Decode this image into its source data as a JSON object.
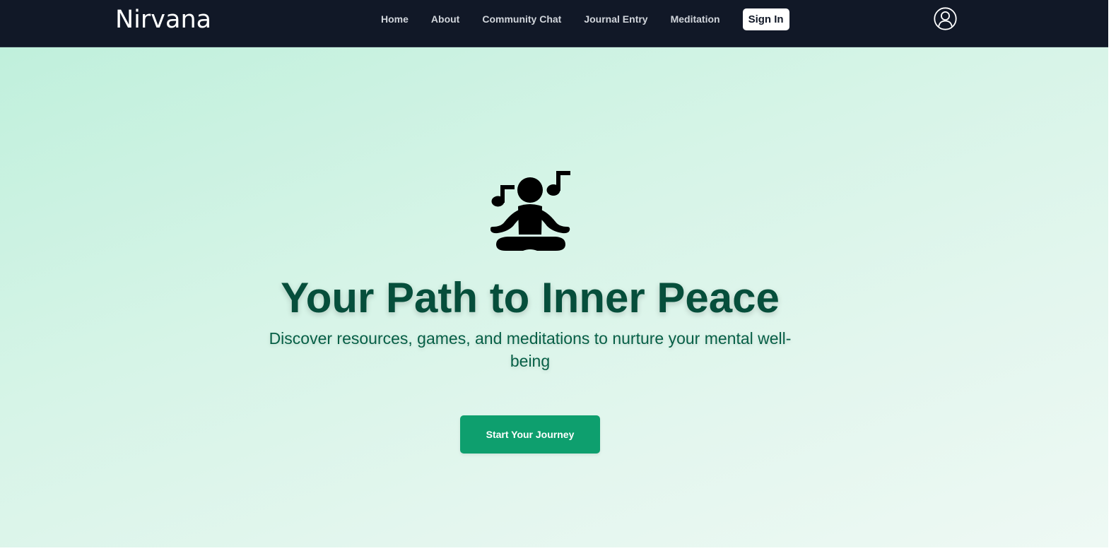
{
  "header": {
    "brand": "Nirvana",
    "nav": [
      {
        "label": "Home"
      },
      {
        "label": "About"
      },
      {
        "label": "Community Chat"
      },
      {
        "label": "Journal Entry"
      },
      {
        "label": "Meditation"
      }
    ],
    "sign_in_label": "Sign In",
    "profile_icon": "user-circle-icon"
  },
  "hero": {
    "icon": "meditation-music-icon",
    "title": "Your Path to Inner Peace",
    "subtitle": "Discover resources, games, and meditations to nurture your mental well-being",
    "cta_label": "Start Your Journey"
  },
  "colors": {
    "navbar_bg": "#111827",
    "hero_title": "#064e3b",
    "cta_bg": "#0e9f6e",
    "hero_gradient_start": "#c0f0dc",
    "hero_gradient_end": "#eef9f4"
  }
}
